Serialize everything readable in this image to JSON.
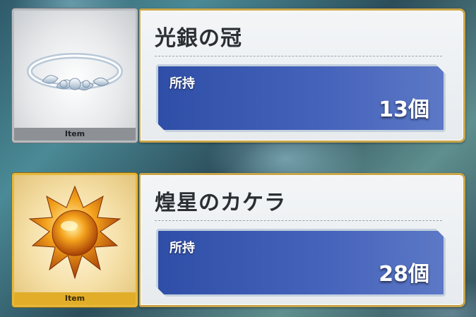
{
  "items": [
    {
      "name": "光銀の冠",
      "badge": "Item",
      "icon": "silver-crown-icon",
      "owned_label": "所持",
      "owned_count": "13個"
    },
    {
      "name": "煌星のカケラ",
      "badge": "Item",
      "icon": "star-fragment-icon",
      "owned_label": "所持",
      "owned_count": "28個"
    }
  ],
  "colors": {
    "silver_frame": "#b9bcbf",
    "gold_frame": "#e6b73a",
    "count_panel": "#3a58b0",
    "panel_border": "#caa64a"
  }
}
